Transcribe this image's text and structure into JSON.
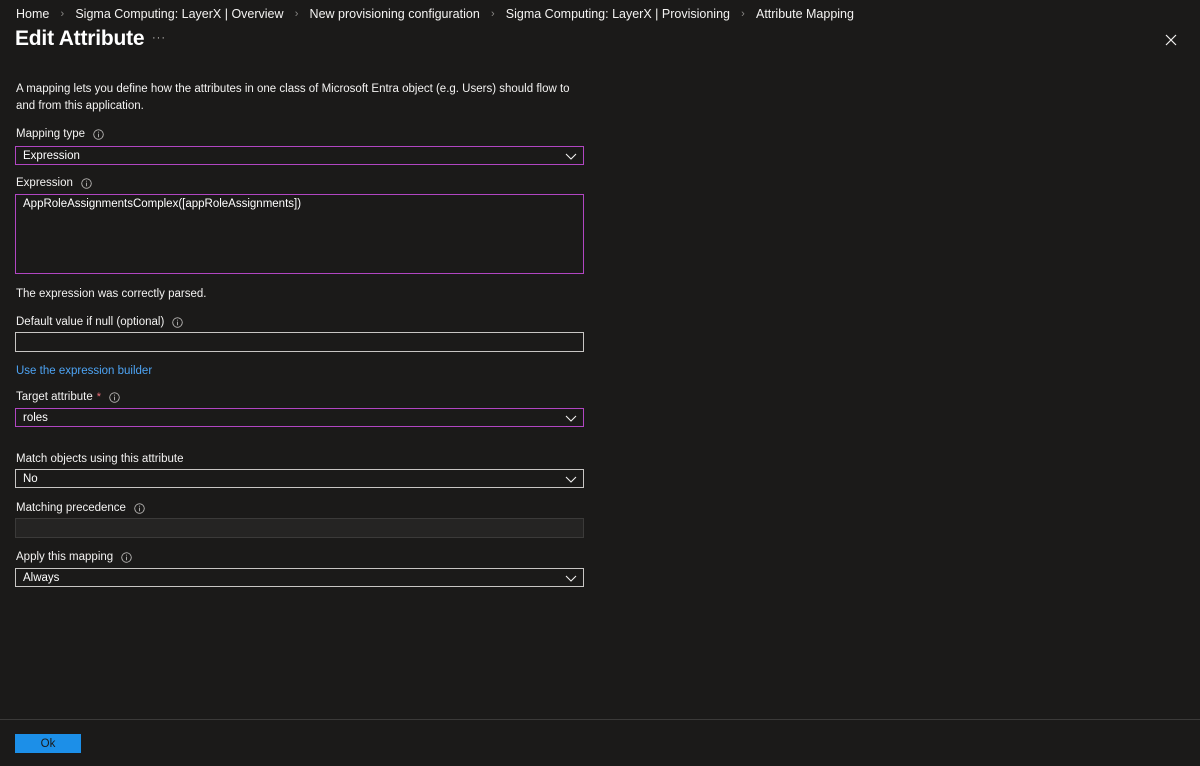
{
  "breadcrumb": {
    "items": [
      {
        "label": "Home"
      },
      {
        "label": "Sigma Computing: LayerX | Overview"
      },
      {
        "label": "New provisioning configuration"
      },
      {
        "label": "Sigma Computing: LayerX | Provisioning"
      },
      {
        "label": "Attribute Mapping"
      }
    ]
  },
  "page": {
    "title": "Edit Attribute",
    "description": "A mapping lets you define how the attributes in one class of Microsoft Entra object (e.g. Users) should flow to and from this application."
  },
  "form": {
    "mapping_type": {
      "label": "Mapping type",
      "value": "Expression"
    },
    "expression": {
      "label": "Expression",
      "value": "AppRoleAssignmentsComplex([appRoleAssignments])"
    },
    "parse_status": "The expression was correctly parsed.",
    "default_value": {
      "label": "Default value if null (optional)",
      "value": ""
    },
    "expression_builder_link": "Use the expression builder",
    "target_attribute": {
      "label": "Target attribute",
      "required_mark": "*",
      "value": "roles"
    },
    "match_objects": {
      "label": "Match objects using this attribute",
      "value": "No"
    },
    "matching_precedence": {
      "label": "Matching precedence",
      "value": ""
    },
    "apply_mapping": {
      "label": "Apply this mapping",
      "value": "Always"
    }
  },
  "footer": {
    "ok_label": "Ok"
  },
  "icons": {
    "more": "more-icon",
    "close": "close-icon",
    "info": "info-icon",
    "chevron": "chevron-down-icon"
  },
  "colors": {
    "background": "#1b1a19",
    "focus_border": "#b146c2",
    "link": "#4da3f3",
    "primary_button": "#1c8fe8",
    "required": "#f1707b"
  }
}
